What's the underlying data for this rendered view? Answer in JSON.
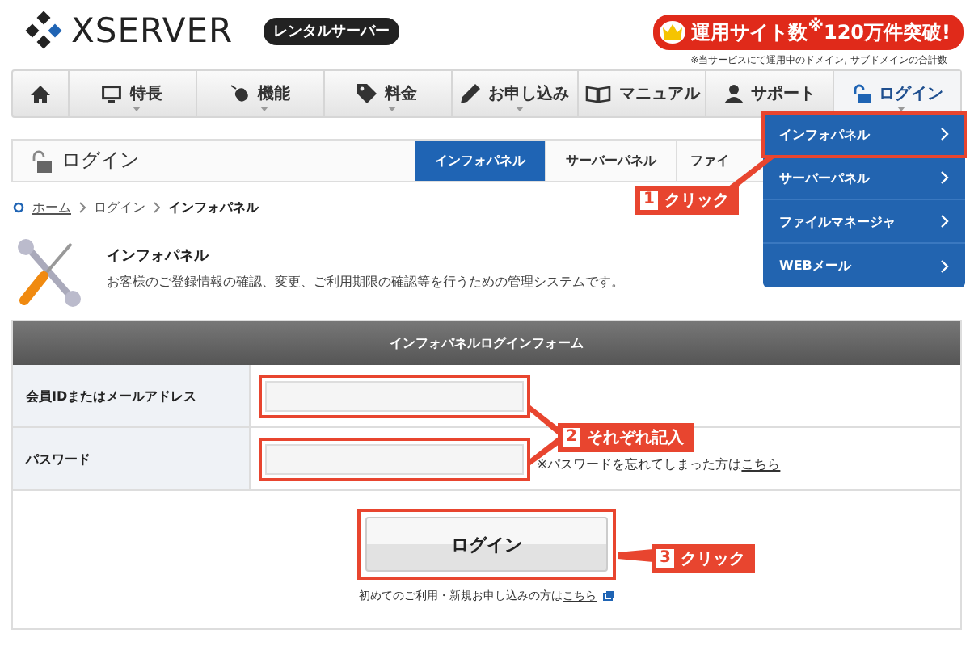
{
  "logo": {
    "name": "XSERVER",
    "badge": "レンタルサーバー"
  },
  "promo": {
    "text": "運用サイト数$^{※}$120万件突破!",
    "note": "※当サービスにて運用中のドメイン, サブドメインの合計数"
  },
  "nav": [
    {
      "kind": "home",
      "submenu": false,
      "selected": false
    },
    {
      "kind": "monitor",
      "label": "特長",
      "submenu": true,
      "selected": false
    },
    {
      "kind": "mouse",
      "label": "機能",
      "submenu": true,
      "selected": false
    },
    {
      "kind": "tag",
      "label": "料金",
      "submenu": true,
      "selected": false
    },
    {
      "kind": "pencil",
      "label": "お申し込み",
      "submenu": true,
      "selected": false
    },
    {
      "kind": "book",
      "label": "マニュアル",
      "submenu": false,
      "selected": false
    },
    {
      "kind": "person",
      "label": "サポート",
      "submenu": false,
      "selected": false
    },
    {
      "kind": "lock",
      "label": "ログイン",
      "submenu": true,
      "selected": true
    }
  ],
  "dropdown": [
    {
      "label": "インフォパネル",
      "highlighted": true
    },
    {
      "label": "サーバーパネル",
      "highlighted": false
    },
    {
      "label": "ファイルマネージャ",
      "highlighted": false
    },
    {
      "label": "WEBメール",
      "highlighted": false
    }
  ],
  "page_header": {
    "title": "ログイン",
    "tabs": [
      {
        "label": "インフォパネル",
        "selected": true
      },
      {
        "label": "サーバーパネル",
        "selected": false
      },
      {
        "label": "ファイ",
        "selected": false
      }
    ]
  },
  "breadcrumb": [
    {
      "label": "ホーム",
      "link": true
    },
    {
      "label": "ログイン",
      "link": false
    },
    {
      "label": "インフォパネル",
      "link": false
    }
  ],
  "intro": {
    "title": "インフォパネル",
    "text": "お客様のご登録情報の確認、変更、ご利用期限の確認等を行うための管理システムです。"
  },
  "form": {
    "title": "インフォパネルログインフォーム",
    "fields": [
      {
        "label": "会員IDまたはメールアドレス",
        "highlighted": true
      },
      {
        "label": "パスワード",
        "highlighted": true,
        "note": "※パスワードを忘れてしまった方は",
        "link": "こちら"
      }
    ],
    "button": {
      "label": "ログイン",
      "highlighted": true
    },
    "signup_text": "初めてのご利用・新規お申し込みの方は",
    "signup_link": "こちら"
  },
  "callouts": [
    {
      "number": "1",
      "text": "クリック"
    },
    {
      "number": "2",
      "text": "それぞれ記入"
    },
    {
      "number": "3",
      "text": "クリック"
    }
  ]
}
